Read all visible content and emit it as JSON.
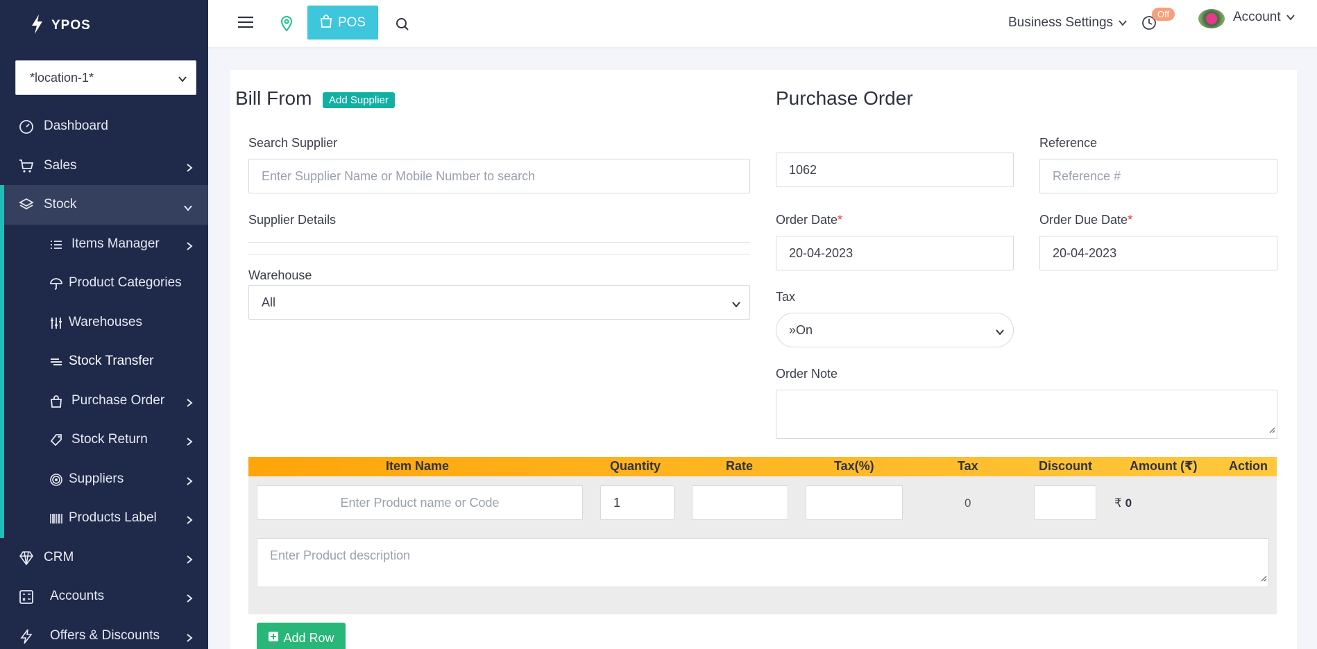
{
  "brand": {
    "name": "YPOS"
  },
  "location_select": {
    "value": "*location-1*"
  },
  "sidebar": {
    "items": [
      {
        "label": "Dashboard",
        "icon": "dashboard-gauge-icon"
      },
      {
        "label": "Sales",
        "icon": "cart-icon"
      },
      {
        "label": "Stock",
        "icon": "layers-icon"
      },
      {
        "label": "CRM",
        "icon": "diamond-icon"
      },
      {
        "label": "Accounts",
        "icon": "calculator-icon"
      },
      {
        "label": "Offers & Discounts",
        "icon": "bolt-icon"
      }
    ],
    "stock_sub": [
      {
        "label": "Items Manager",
        "icon": "list-icon"
      },
      {
        "label": "Product Categories",
        "icon": "umbrella-icon"
      },
      {
        "label": "Warehouses",
        "icon": "sliders-icon"
      },
      {
        "label": "Stock Transfer",
        "icon": "transfer-lines-icon"
      },
      {
        "label": "Purchase Order",
        "icon": "bag-icon"
      },
      {
        "label": "Stock Return",
        "icon": "tag-return-icon"
      },
      {
        "label": "Suppliers",
        "icon": "target-icon"
      },
      {
        "label": "Products Label",
        "icon": "barcode-icon"
      }
    ]
  },
  "topbar": {
    "pos_label": "POS",
    "business_settings": "Business Settings",
    "off_badge": "Off",
    "account": "Account"
  },
  "form": {
    "bill_from": "Bill From",
    "add_supplier": "Add Supplier",
    "search_supplier_label": "Search Supplier",
    "search_supplier_placeholder": "Enter Supplier Name or Mobile Number to search",
    "supplier_details": "Supplier Details",
    "warehouse_label": "Warehouse",
    "warehouse_value": "All",
    "purchase_order_title": "Purchase Order",
    "order_number": "1062",
    "reference_label": "Reference",
    "reference_placeholder": "Reference #",
    "order_date_label": "Order Date",
    "order_date": "20-04-2023",
    "order_due_date_label": "Order Due Date",
    "order_due_date": "20-04-2023",
    "required_mark": "*",
    "tax_label": "Tax",
    "tax_value": "»On",
    "order_note_label": "Order Note"
  },
  "items_table": {
    "headers": [
      "Item Name",
      "Quantity",
      "Rate",
      "Tax(%)",
      "Tax",
      "Discount",
      "Amount (₹)",
      "Action"
    ],
    "product_placeholder": "Enter Product name or Code",
    "quantity": "1",
    "tax_value": "0",
    "currency": "₹",
    "amount": "0",
    "description_placeholder": "Enter Product description"
  },
  "add_row": "Add Row",
  "colors": {
    "sidebar_bg": "#1f2a4a",
    "accent_teal": "#1fbfb8",
    "pos_button": "#3ec6dc",
    "table_header": "#ffa50a",
    "add_row_green": "#28b779"
  }
}
